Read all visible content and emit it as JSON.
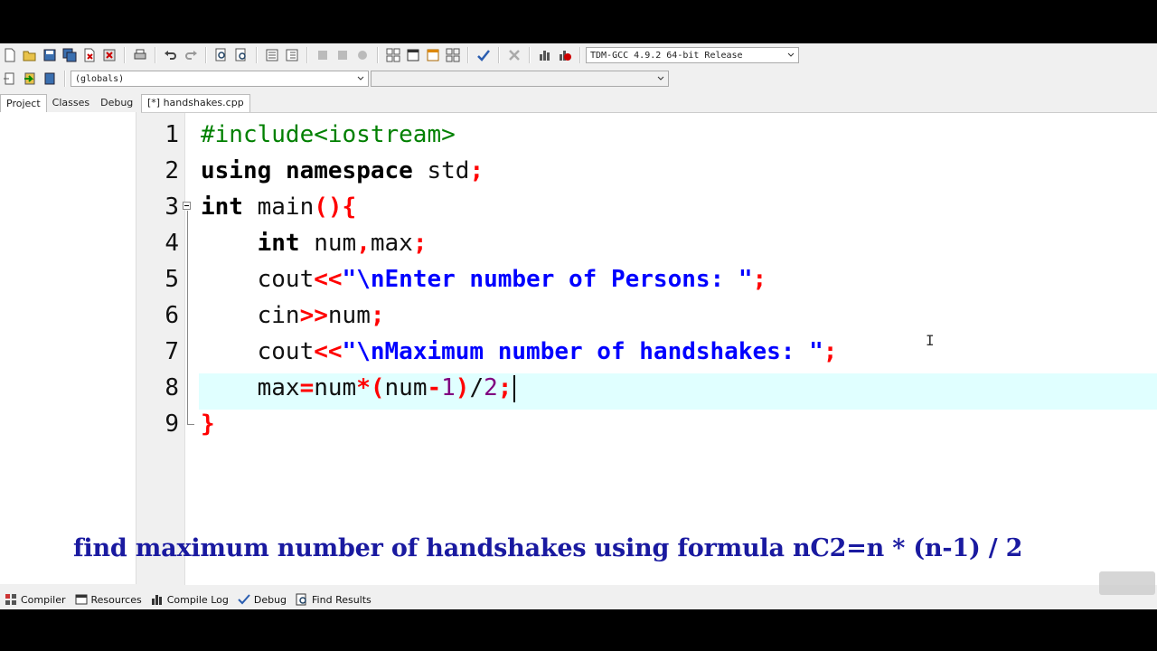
{
  "toolbar": {
    "compiler_select": "TDM-GCC 4.9.2 64-bit Release",
    "scope_select": "(globals)",
    "function_select": ""
  },
  "left_panel": {
    "tabs": [
      "Project",
      "Classes",
      "Debug"
    ]
  },
  "editor": {
    "file_tab": "[*] handshakes.cpp",
    "line_numbers": [
      "1",
      "2",
      "3",
      "4",
      "5",
      "6",
      "7",
      "8",
      "9"
    ],
    "current_line": 8
  },
  "caption": "find maximum number of handshakes using formula nC2=n * (n-1) / 2",
  "bottom_tabs": [
    "Compiler",
    "Resources",
    "Compile Log",
    "Debug",
    "Find Results"
  ],
  "colors": {
    "keyword": "#000000",
    "preprocessor": "#008000",
    "operator": "#ff0000",
    "string": "#0000ff",
    "number": "#800080",
    "current_line": "#e0ffff",
    "caption": "#1a1aa0"
  }
}
